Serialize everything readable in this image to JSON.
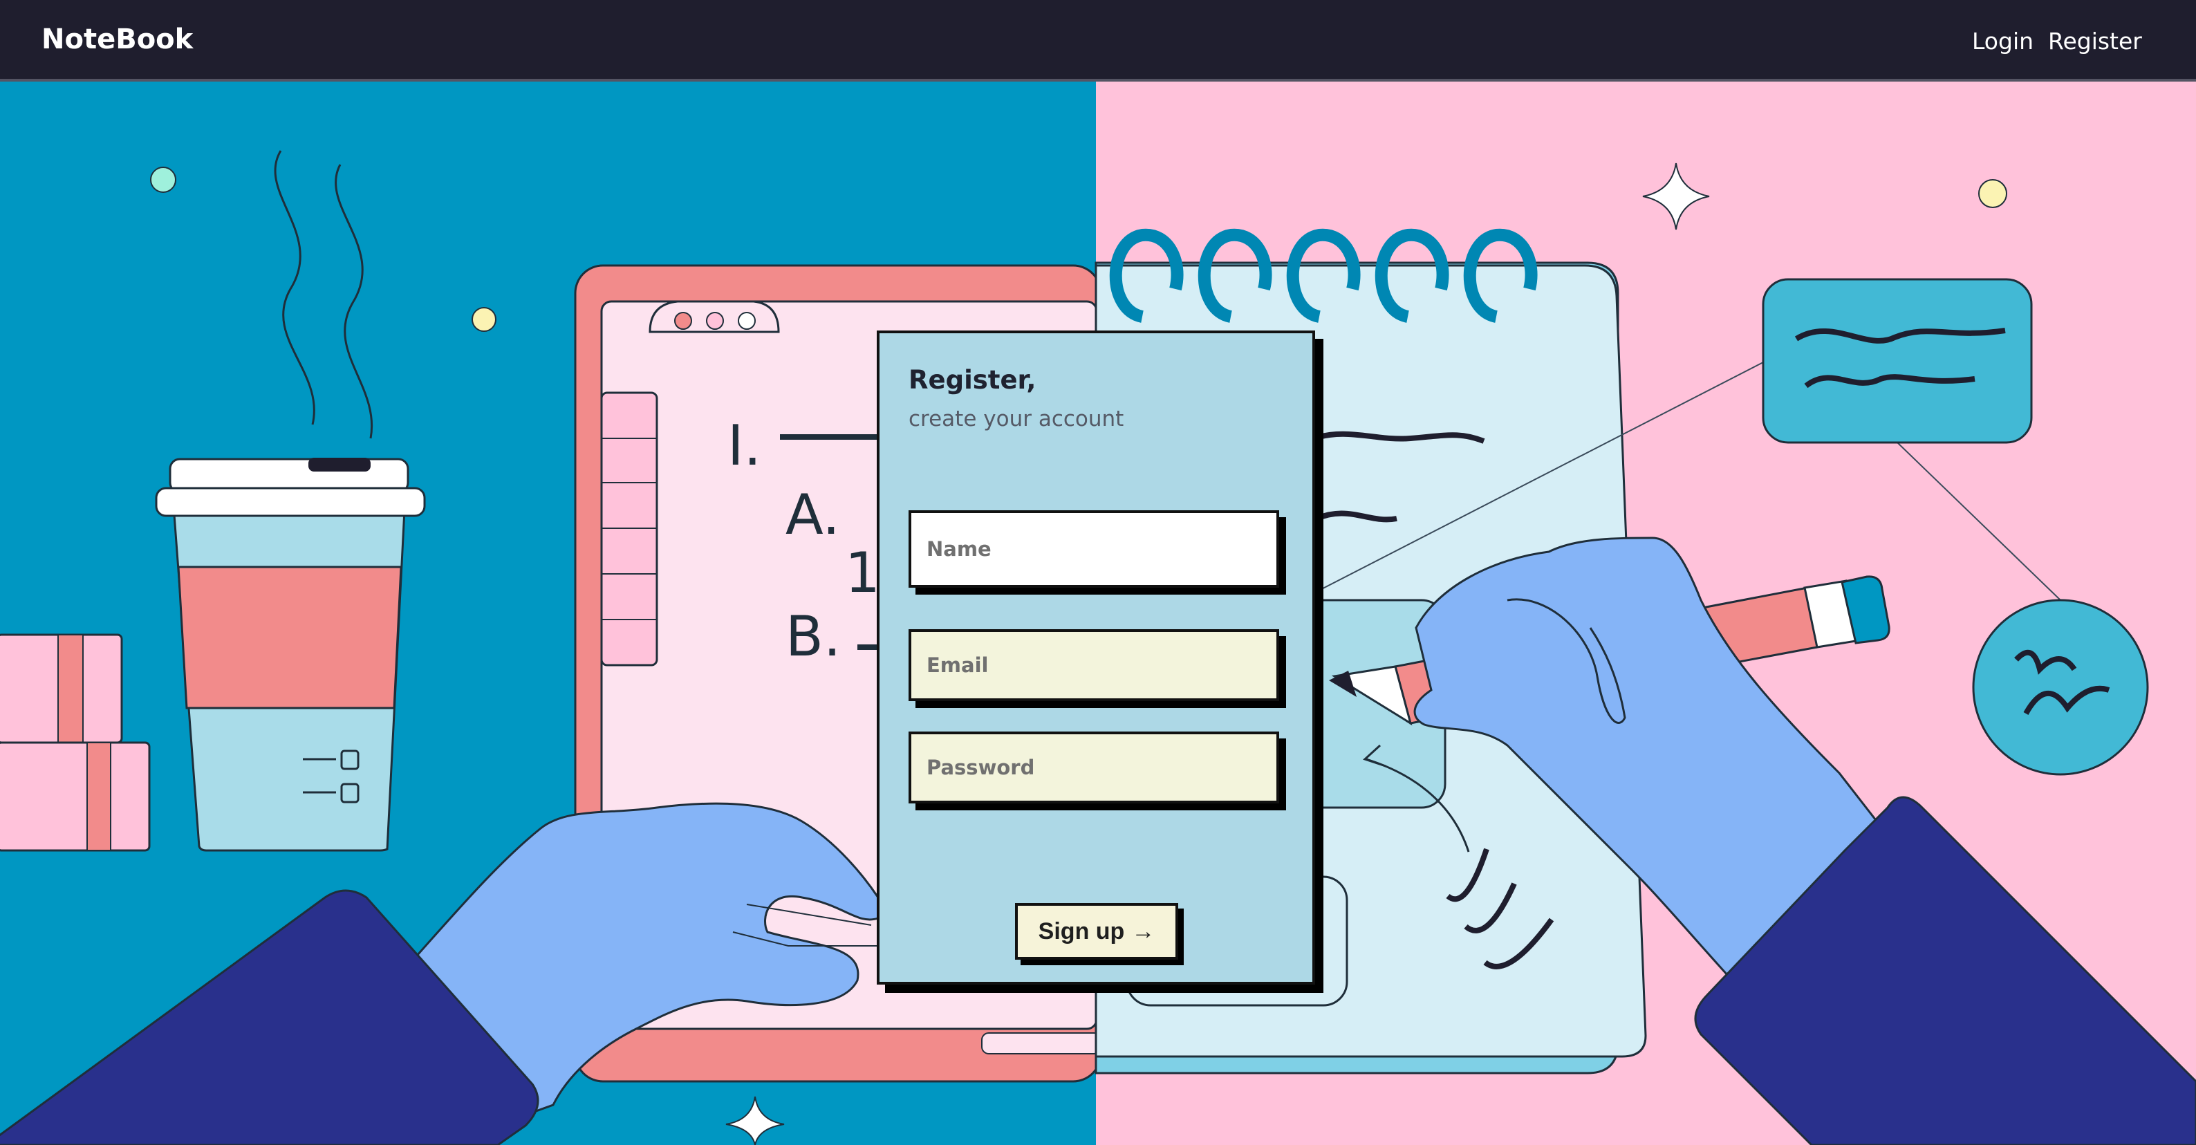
{
  "navbar": {
    "brand": "NoteBook",
    "links": [
      {
        "label": "Login"
      },
      {
        "label": "Register"
      }
    ]
  },
  "form": {
    "title": "Register,",
    "subtitle": "create your account",
    "fields": {
      "name_placeholder": "Name",
      "email_placeholder": "Email",
      "password_placeholder": "Password",
      "name_value": "",
      "email_value": "",
      "password_value": ""
    },
    "submit_label": "Sign up",
    "submit_arrow": "→"
  },
  "illustration": {
    "colors": {
      "left_bg": "#0097c2",
      "right_bg": "#ffc2da",
      "coral": "#f28b8b",
      "periwinkle": "#85b4f7",
      "navy": "#29308c",
      "light_blue": "#a9dce9",
      "teal": "#42b9d5"
    }
  }
}
